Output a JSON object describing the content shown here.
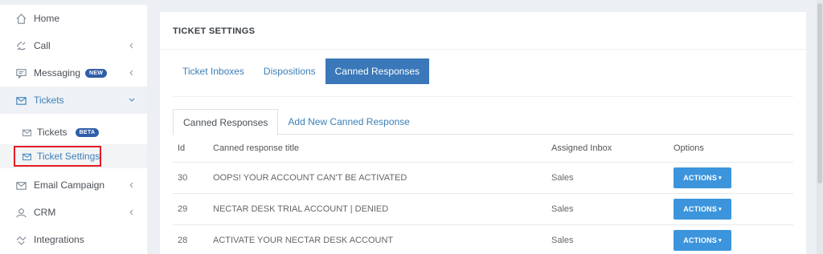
{
  "sidebar": {
    "items": [
      {
        "label": "Home",
        "icon": "home-icon"
      },
      {
        "label": "Call",
        "icon": "phone-icon"
      },
      {
        "label": "Messaging",
        "icon": "chat-icon",
        "badge": "NEW"
      },
      {
        "label": "Tickets",
        "icon": "mail-icon"
      },
      {
        "label": "Email Campaign",
        "icon": "mail-icon"
      },
      {
        "label": "CRM",
        "icon": "user-icon"
      },
      {
        "label": "Integrations",
        "icon": "handshake-icon"
      }
    ],
    "sub_items": [
      {
        "label": "Tickets",
        "icon": "mail-icon",
        "badge": "BETA"
      },
      {
        "label": "Ticket Settings",
        "icon": "mail-icon"
      }
    ]
  },
  "main": {
    "title": "TICKET SETTINGS",
    "tabs": [
      "Ticket Inboxes",
      "Dispositions",
      "Canned Responses"
    ],
    "sub_tabs": [
      "Canned Responses",
      "Add New Canned Response"
    ],
    "table": {
      "headers": [
        "Id",
        "Canned response title",
        "Assigned Inbox",
        "Options"
      ],
      "rows": [
        {
          "id": "30",
          "title": "OOPS! YOUR ACCOUNT CAN'T BE ACTIVATED",
          "inbox": "Sales",
          "action": "ACTIONS"
        },
        {
          "id": "29",
          "title": "NECTAR DESK TRIAL ACCOUNT | DENIED",
          "inbox": "Sales",
          "action": "ACTIONS"
        },
        {
          "id": "28",
          "title": "ACTIVATE YOUR NECTAR DESK ACCOUNT",
          "inbox": "Sales",
          "action": "ACTIONS"
        }
      ]
    }
  },
  "colors": {
    "accent": "#3a78b9",
    "button": "#3c95dc",
    "highlight": "#e51c23"
  }
}
